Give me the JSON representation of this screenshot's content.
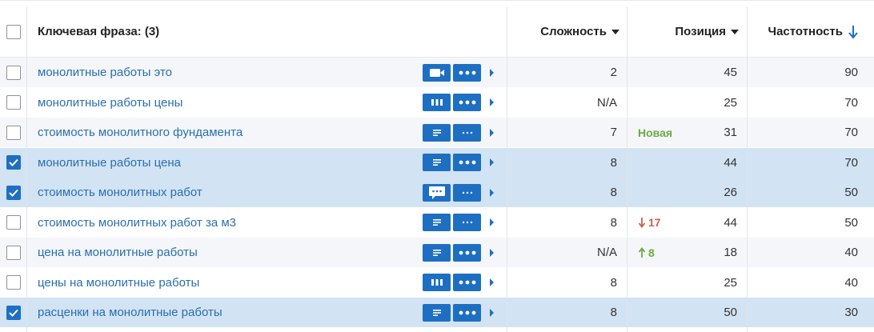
{
  "header": {
    "phrase_label": "Ключевая фраза: (3)",
    "complexity_label": "Сложность",
    "position_label": "Позиция",
    "frequency_label": "Частотность"
  },
  "colors": {
    "accent": "#1e6fc2",
    "link": "#2a6fb0",
    "up": "#6aaa44",
    "down": "#d0604f",
    "selected_row": "#d2e3f3"
  },
  "rows": [
    {
      "phrase": "монолитные работы это",
      "checked": false,
      "tool": "video-icon",
      "more": "dots",
      "complexity": "2",
      "dynamics": "",
      "dyn_type": "",
      "position": "45",
      "frequency": "90"
    },
    {
      "phrase": "монолитные работы цены",
      "checked": false,
      "tool": "columns-icon",
      "more": "dots",
      "complexity": "N/A",
      "dynamics": "",
      "dyn_type": "",
      "position": "25",
      "frequency": "70"
    },
    {
      "phrase": "стоимость монолитного фундамента",
      "checked": false,
      "tool": "list-icon",
      "more": "small-dots",
      "complexity": "7",
      "dynamics": "Новая",
      "dyn_type": "new",
      "position": "31",
      "frequency": "70"
    },
    {
      "phrase": "монолитные работы цена",
      "checked": true,
      "tool": "list-icon",
      "more": "dots",
      "complexity": "8",
      "dynamics": "",
      "dyn_type": "",
      "position": "44",
      "frequency": "70"
    },
    {
      "phrase": "стоимость монолитных работ",
      "checked": true,
      "tool": "chat-icon",
      "more": "small-dots",
      "complexity": "8",
      "dynamics": "",
      "dyn_type": "",
      "position": "26",
      "frequency": "50"
    },
    {
      "phrase": "стоимость монолитных работ за м3",
      "checked": false,
      "tool": "list-icon",
      "more": "small-dots",
      "complexity": "8",
      "dynamics": "17",
      "dyn_type": "down",
      "position": "44",
      "frequency": "50"
    },
    {
      "phrase": "цена на монолитные работы",
      "checked": false,
      "tool": "list-icon",
      "more": "dots",
      "complexity": "N/A",
      "dynamics": "8",
      "dyn_type": "up",
      "position": "18",
      "frequency": "40"
    },
    {
      "phrase": "цены на монолитные работы",
      "checked": false,
      "tool": "columns-icon",
      "more": "dots",
      "complexity": "8",
      "dynamics": "",
      "dyn_type": "",
      "position": "25",
      "frequency": "40"
    },
    {
      "phrase": "расценки на монолитные работы",
      "checked": true,
      "tool": "list-icon",
      "more": "dots",
      "complexity": "8",
      "dynamics": "",
      "dyn_type": "",
      "position": "50",
      "frequency": "30"
    }
  ]
}
